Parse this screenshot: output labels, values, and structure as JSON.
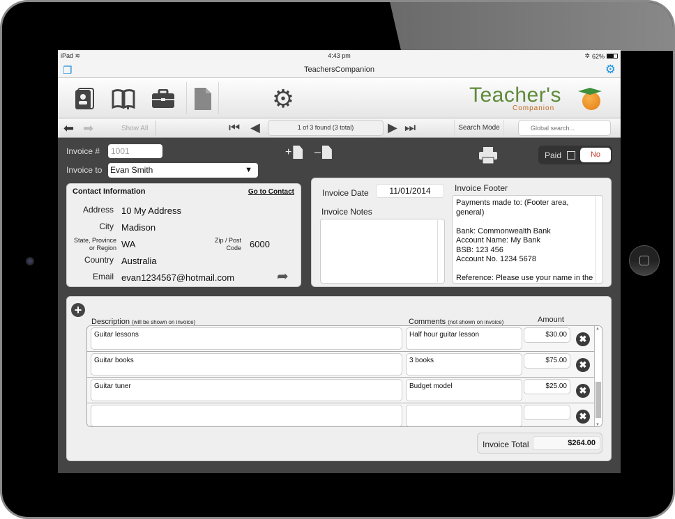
{
  "status_bar": {
    "device": "iPad",
    "time": "4:43 pm",
    "battery": "62%",
    "battery_fraction": 0.62
  },
  "nav_bar": {
    "title": "TeachersCompanion"
  },
  "toolbar": {
    "icons": [
      "contacts-icon",
      "book-icon",
      "briefcase-icon",
      "document-icon",
      "gear-icon"
    ],
    "logo_main": "Teacher's",
    "logo_sub": "Companion"
  },
  "record_nav": {
    "show_all": "Show All",
    "found": "1 of 3 found (3 total)",
    "search_mode": "Search Mode",
    "global_search_placeholder": "Global search..."
  },
  "invoice": {
    "number_label": "Invoice #",
    "number": "1001",
    "to_label": "Invoice to",
    "to": "Evan Smith",
    "paid_label": "Paid",
    "paid_value": "No"
  },
  "contact": {
    "title": "Contact Information",
    "goto": "Go to Contact",
    "address_label": "Address",
    "address": "10 My Address",
    "city_label": "City",
    "city": "Madison",
    "state_label_1": "State, Province",
    "state_label_2": "or Region",
    "state": "WA",
    "zip_label_1": "Zip / Post",
    "zip_label_2": "Code",
    "zip": "6000",
    "country_label": "Country",
    "country": "Australia",
    "email_label": "Email",
    "email": "evan1234567@hotmail.com"
  },
  "details": {
    "date_label": "Invoice Date",
    "date": "11/01/2014",
    "notes_label": "Invoice Notes",
    "notes": "",
    "footer_label": "Invoice Footer",
    "footer": "Payments made to: (Footer area,\ngeneral)\n\nBank: Commonwealth Bank\nAccount Name: My Bank\nBSB: 123 456\nAccount No. 1234 5678\n\nReference: Please use your name in the"
  },
  "items": {
    "description_header": "Description",
    "description_note": "(will be shown on invoice)",
    "comments_header": "Comments",
    "comments_note": "(not shown on invoice)",
    "amount_header": "Amount",
    "rows": [
      {
        "description": "Guitar lessons",
        "comment": "Half hour guitar lesson",
        "amount": "$30.00"
      },
      {
        "description": "Guitar books",
        "comment": "3 books",
        "amount": "$75.00"
      },
      {
        "description": "Guitar tuner",
        "comment": "Budget model",
        "amount": "$25.00"
      },
      {
        "description": "",
        "comment": "",
        "amount": ""
      }
    ],
    "total_label": "Invoice Total",
    "total": "$264.00"
  }
}
